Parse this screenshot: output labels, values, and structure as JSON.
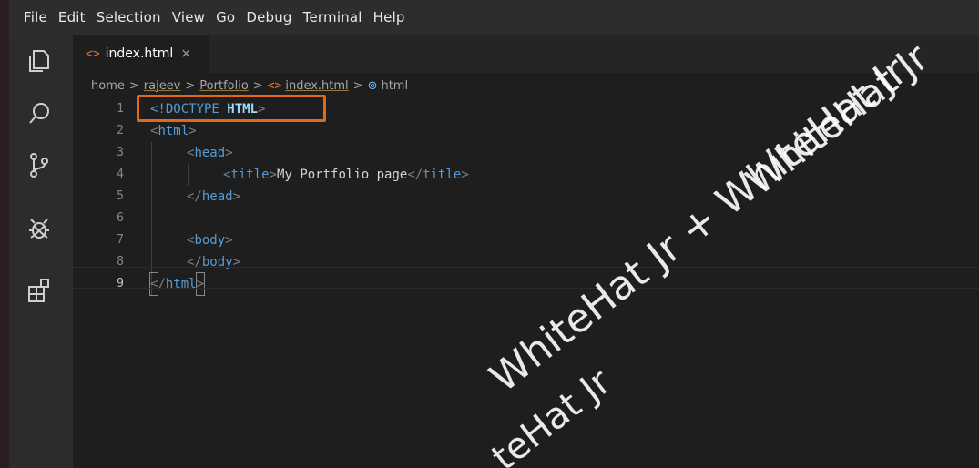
{
  "menu": [
    "File",
    "Edit",
    "Selection",
    "View",
    "Go",
    "Debug",
    "Terminal",
    "Help"
  ],
  "activity_icons": [
    "explorer-icon",
    "search-icon",
    "source-control-icon",
    "debug-icon",
    "extensions-icon"
  ],
  "tab": {
    "file_icon": "<>",
    "label": "index.html",
    "close": "×"
  },
  "breadcrumb": {
    "items": [
      "home",
      "rajeev",
      "Portfolio"
    ],
    "file_icon": "<>",
    "file": "index.html",
    "element_icon": "⊚",
    "element": "html",
    "separator": ">"
  },
  "editor": {
    "line_numbers": [
      "1",
      "2",
      "3",
      "4",
      "5",
      "6",
      "7",
      "8",
      "9"
    ],
    "line1": {
      "open": "<!DOCTYPE",
      "kw": "HTML",
      "close": ">"
    },
    "line2": {
      "lt": "<",
      "tag": "html",
      "gt": ">"
    },
    "line3": {
      "lt": "<",
      "tag": "head",
      "gt": ">"
    },
    "line4": {
      "lt": "<",
      "tag_open": "title",
      "gt": ">",
      "text": "My Portfolio page",
      "lt_close": "</",
      "tag_close": "title",
      "gt_close": ">"
    },
    "line5": {
      "lt": "</",
      "tag": "head",
      "gt": ">"
    },
    "line7": {
      "lt": "<",
      "tag": "body",
      "gt": ">"
    },
    "line8": {
      "lt": "</",
      "tag": "body",
      "gt": ">"
    },
    "line9": {
      "lt": "<",
      "slash": "/",
      "tag": "html",
      "gt": ">"
    }
  },
  "watermark": {
    "text1": "WhiteHat Jr",
    "text2": "WhiteHat Jr + WhiteHat Jr",
    "text3": "teHat Jr"
  },
  "colors": {
    "highlight": "#e06a1b",
    "tag": "#569cd6",
    "html_file_icon": "#e37933"
  }
}
